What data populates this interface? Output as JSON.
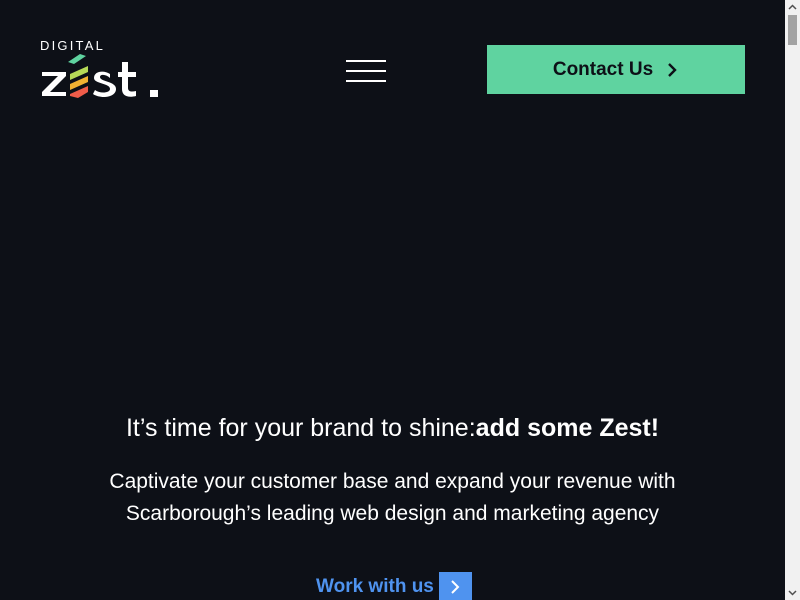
{
  "header": {
    "logo": {
      "top_text": "DIGITAL",
      "main_text": "zest."
    },
    "menu_icon": "hamburger-menu-icon",
    "contact_button": {
      "label": "Contact Us",
      "icon": "chevron-right-icon",
      "background_color": "#5fd3a0"
    }
  },
  "hero": {
    "headline_regular": "It’s time for your brand to shine:",
    "headline_bold": "add some Zest!",
    "subtext": "Captivate your customer base and expand your revenue with Scarborough’s leading web design and marketing agency",
    "cta": {
      "label": "Work with us",
      "icon": "chevron-right-icon",
      "color": "#4f93ef"
    }
  },
  "colors": {
    "background": "#0d1017",
    "text": "#ffffff",
    "accent_green": "#5fd3a0",
    "accent_blue": "#4f93ef"
  }
}
